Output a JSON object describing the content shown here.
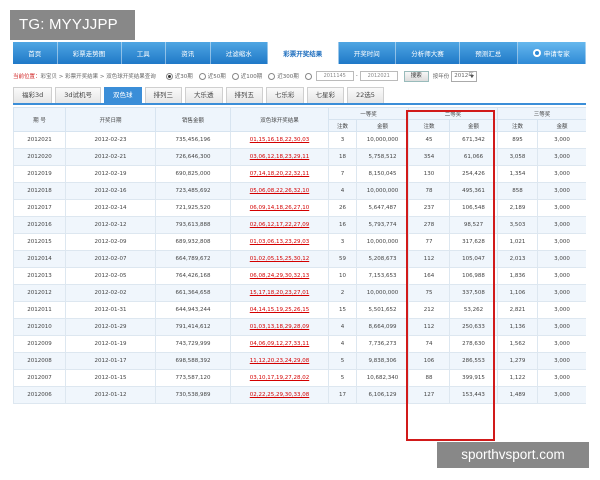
{
  "tag": "TG: MYYJJPP",
  "watermark": "sporthvsport.com",
  "nav": {
    "items": [
      {
        "label": "首页"
      },
      {
        "label": "彩票走势图"
      },
      {
        "label": "工具"
      },
      {
        "label": "资讯"
      },
      {
        "label": "过滤缩水"
      },
      {
        "label": "彩票开奖结果",
        "active": true
      },
      {
        "label": "开奖时间"
      },
      {
        "label": "分析师大赛"
      },
      {
        "label": "预测汇总"
      },
      {
        "label": "申请专家",
        "icon": "apply-icon"
      }
    ]
  },
  "location": {
    "prefix": "当前位置：",
    "path": "彩宝贝 > 彩票开奖结果 > 双色球开奖结果查询",
    "options": [
      "近30期",
      "近50期",
      "近100期",
      "近300期"
    ],
    "date_from": "2011145",
    "date_to": "2012021",
    "search": "搜索",
    "year_label": "按年份",
    "year_value": "2012年"
  },
  "tabs": [
    {
      "label": "福彩3d"
    },
    {
      "label": "3d试机号"
    },
    {
      "label": "双色球",
      "active": true
    },
    {
      "label": "排列三"
    },
    {
      "label": "大乐透"
    },
    {
      "label": "排列五"
    },
    {
      "label": "七乐彩"
    },
    {
      "label": "七星彩"
    },
    {
      "label": "22选5"
    }
  ],
  "table": {
    "headers": {
      "issue": "期 号",
      "date": "开奖日期",
      "sales": "销售金额",
      "numbers": "双色球开奖结果",
      "first": "一等奖",
      "second": "二等奖",
      "third": "三等奖",
      "count": "注数",
      "amount": "金额"
    },
    "rows": [
      {
        "issue": "2012021",
        "date": "2012-02-23",
        "sales": "735,456,196",
        "numbers": "01,15,16,18,22,30,03",
        "c1": "3",
        "a1": "10,000,000",
        "c2": "45",
        "a2": "671,342",
        "c3": "895",
        "a3": "3,000"
      },
      {
        "issue": "2012020",
        "date": "2012-02-21",
        "sales": "726,646,300",
        "numbers": "03,06,12,18,23,29,11",
        "c1": "18",
        "a1": "5,758,512",
        "c2": "354",
        "a2": "61,066",
        "c3": "3,058",
        "a3": "3,000"
      },
      {
        "issue": "2012019",
        "date": "2012-02-19",
        "sales": "690,825,000",
        "numbers": "07,14,18,20,22,32,11",
        "c1": "7",
        "a1": "8,150,045",
        "c2": "130",
        "a2": "254,426",
        "c3": "1,354",
        "a3": "3,000"
      },
      {
        "issue": "2012018",
        "date": "2012-02-16",
        "sales": "723,485,692",
        "numbers": "05,06,08,22,26,32,10",
        "c1": "4",
        "a1": "10,000,000",
        "c2": "78",
        "a2": "495,361",
        "c3": "858",
        "a3": "3,000"
      },
      {
        "issue": "2012017",
        "date": "2012-02-14",
        "sales": "721,925,520",
        "numbers": "06,09,14,18,26,27,10",
        "c1": "26",
        "a1": "5,647,487",
        "c2": "237",
        "a2": "106,548",
        "c3": "2,189",
        "a3": "3,000"
      },
      {
        "issue": "2012016",
        "date": "2012-02-12",
        "sales": "793,613,888",
        "numbers": "02,06,12,17,22,27,09",
        "c1": "16",
        "a1": "5,793,774",
        "c2": "278",
        "a2": "98,527",
        "c3": "3,503",
        "a3": "3,000"
      },
      {
        "issue": "2012015",
        "date": "2012-02-09",
        "sales": "689,932,808",
        "numbers": "01,03,06,13,23,29,03",
        "c1": "3",
        "a1": "10,000,000",
        "c2": "77",
        "a2": "317,628",
        "c3": "1,021",
        "a3": "3,000"
      },
      {
        "issue": "2012014",
        "date": "2012-02-07",
        "sales": "664,789,672",
        "numbers": "01,02,05,15,25,30,12",
        "c1": "59",
        "a1": "5,208,673",
        "c2": "112",
        "a2": "105,047",
        "c3": "2,013",
        "a3": "3,000"
      },
      {
        "issue": "2012013",
        "date": "2012-02-05",
        "sales": "764,426,168",
        "numbers": "06,08,24,29,30,32,13",
        "c1": "10",
        "a1": "7,153,653",
        "c2": "164",
        "a2": "106,988",
        "c3": "1,836",
        "a3": "3,000"
      },
      {
        "issue": "2012012",
        "date": "2012-02-02",
        "sales": "661,364,658",
        "numbers": "15,17,18,20,23,27,01",
        "c1": "2",
        "a1": "10,000,000",
        "c2": "75",
        "a2": "337,508",
        "c3": "1,106",
        "a3": "3,000"
      },
      {
        "issue": "2012011",
        "date": "2012-01-31",
        "sales": "644,943,244",
        "numbers": "04,14,15,19,25,26,15",
        "c1": "15",
        "a1": "5,501,652",
        "c2": "212",
        "a2": "53,262",
        "c3": "2,821",
        "a3": "3,000"
      },
      {
        "issue": "2012010",
        "date": "2012-01-29",
        "sales": "791,414,612",
        "numbers": "01,03,13,18,29,28,09",
        "c1": "4",
        "a1": "8,664,099",
        "c2": "112",
        "a2": "250,633",
        "c3": "1,136",
        "a3": "3,000"
      },
      {
        "issue": "2012009",
        "date": "2012-01-19",
        "sales": "743,729,999",
        "numbers": "04,06,09,12,27,33,11",
        "c1": "4",
        "a1": "7,736,273",
        "c2": "74",
        "a2": "278,630",
        "c3": "1,562",
        "a3": "3,000"
      },
      {
        "issue": "2012008",
        "date": "2012-01-17",
        "sales": "698,588,392",
        "numbers": "11,12,20,23,24,29,08",
        "c1": "5",
        "a1": "9,838,306",
        "c2": "106",
        "a2": "286,553",
        "c3": "1,279",
        "a3": "3,000"
      },
      {
        "issue": "2012007",
        "date": "2012-01-15",
        "sales": "773,587,120",
        "numbers": "03,10,17,19,27,28,02",
        "c1": "5",
        "a1": "10,682,340",
        "c2": "88",
        "a2": "399,915",
        "c3": "1,122",
        "a3": "3,000"
      },
      {
        "issue": "2012006",
        "date": "2012-01-12",
        "sales": "730,538,989",
        "numbers": "02,22,25,29,30,33,08",
        "c1": "17",
        "a1": "6,106,129",
        "c2": "127",
        "a2": "153,443",
        "c3": "1,489",
        "a3": "3,000"
      }
    ]
  },
  "colors": {
    "nav_blue": "#1f78c7",
    "highlight_red": "#d11a1a",
    "ball_red": "#d40000",
    "row_alt": "#f0f6fc"
  }
}
